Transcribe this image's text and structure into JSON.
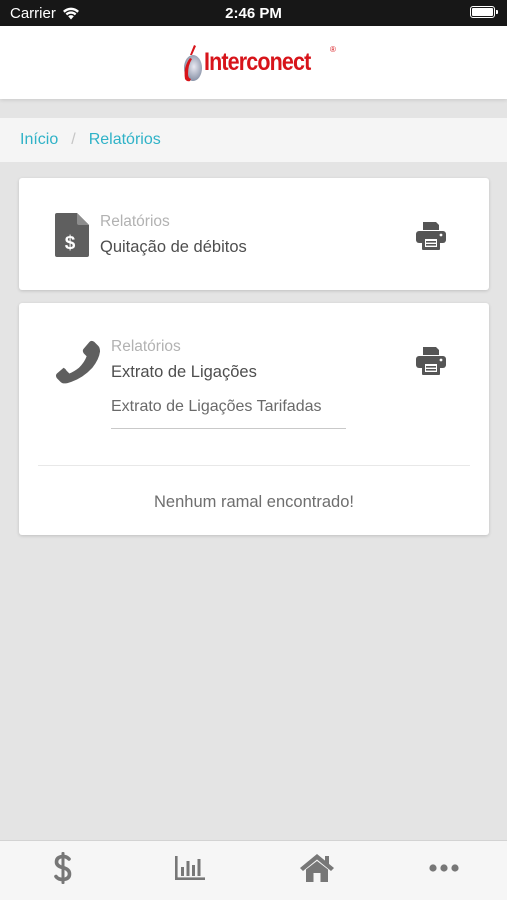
{
  "status_bar": {
    "carrier": "Carrier",
    "time": "2:46 PM"
  },
  "header": {
    "brand": "Interconect",
    "registered": "®",
    "colors": {
      "brand": "#d7141a",
      "accent": "#2fb2c7"
    }
  },
  "breadcrumb": {
    "home": "Início",
    "separator": "/",
    "current": "Relatórios"
  },
  "cards": [
    {
      "category": "Relatórios",
      "title": "Quitação de débitos",
      "icon": "invoice-dollar-icon",
      "action_icon": "print-icon"
    },
    {
      "category": "Relatórios",
      "title": "Extrato de Ligações",
      "icon": "phone-icon",
      "action_icon": "print-icon",
      "select_value": "Extrato de Ligações Tarifadas",
      "empty_message": "Nenhum ramal encontrado!"
    }
  ],
  "tab_bar": [
    {
      "icon": "dollar-icon"
    },
    {
      "icon": "bar-chart-icon"
    },
    {
      "icon": "home-icon"
    },
    {
      "icon": "more-icon"
    }
  ]
}
